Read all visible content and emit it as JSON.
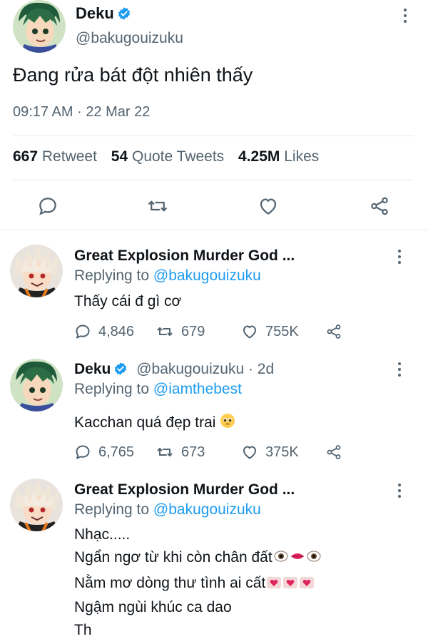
{
  "main_tweet": {
    "display_name": "Deku",
    "handle": "@bakugouizuku",
    "text": "Đang rửa bát đột nhiên thấy",
    "time": "09:17 AM",
    "date_sep": "·",
    "date": "22 Mar 22",
    "stats": {
      "retweets_count": "667",
      "retweets_label": "Retweet",
      "quotes_count": "54",
      "quotes_label": "Quote Tweets",
      "likes_count": "4.25M",
      "likes_label": "Likes"
    }
  },
  "replies": [
    {
      "display_name": "Great Explosion Murder God ...",
      "replying_prefix": "Replying to",
      "replying_to": "@bakugouizuku",
      "text": "Thấy cái đ gì cơ",
      "reply_count": "4,846",
      "retweet_count": "679",
      "like_count": "755K"
    },
    {
      "display_name": "Deku",
      "handle_time": "@bakugouizuku · 2d",
      "replying_prefix": "Replying to",
      "replying_to": "@iamthebest",
      "text": "Kacchan quá đẹp trai",
      "reply_count": "6,765",
      "retweet_count": "673",
      "like_count": "375K"
    },
    {
      "display_name": "Great Explosion Murder God ...",
      "replying_prefix": "Replying to",
      "replying_to": "@bakugouizuku",
      "lines": [
        "Nhạc.....",
        "Ngẩn ngơ từ khi còn chân đất",
        "Nằm mơ dòng thư tình ai cất",
        "Ngậm ngùi khúc ca dao",
        "Th"
      ]
    }
  ],
  "colors": {
    "link": "#1d9bf0",
    "muted": "#536471",
    "verified": "#1d9bf0"
  }
}
